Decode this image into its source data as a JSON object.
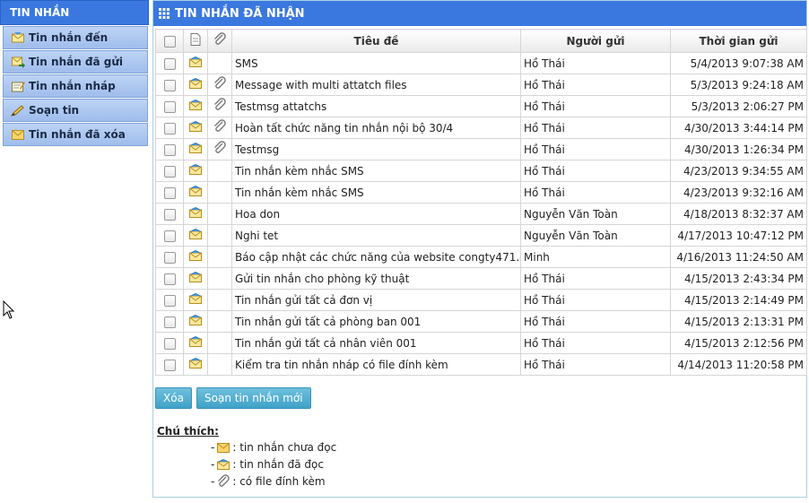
{
  "sidebar": {
    "header": "TIN NHẮN",
    "items": [
      {
        "label": "Tin nhắn đến",
        "icon": "inbox-icon"
      },
      {
        "label": "Tin nhắn đã gửi",
        "icon": "sent-icon"
      },
      {
        "label": "Tin nhắn nháp",
        "icon": "draft-icon"
      },
      {
        "label": "Soạn tin",
        "icon": "compose-icon"
      },
      {
        "label": "Tin nhắn đã xóa",
        "icon": "deleted-icon"
      }
    ]
  },
  "main": {
    "title": "TIN NHẮN ĐÃ NHẬN",
    "columns": {
      "subject": "Tiêu đề",
      "sender": "Người gửi",
      "time": "Thời gian gửi"
    },
    "rows": [
      {
        "subject": "SMS",
        "sender": "Hồ Thái",
        "time": "5/4/2013 9:07:38 AM",
        "attach": false
      },
      {
        "subject": "Message with multi attatch files",
        "sender": "Hồ Thái",
        "time": "5/3/2013 9:24:18 AM",
        "attach": true
      },
      {
        "subject": "Testmsg attatchs",
        "sender": "Hồ Thái",
        "time": "5/3/2013 2:06:27 PM",
        "attach": true
      },
      {
        "subject": "Hoàn tất chức năng tin nhắn nội bộ 30/4",
        "sender": "Hồ Thái",
        "time": "4/30/2013 3:44:14 PM",
        "attach": true
      },
      {
        "subject": "Testmsg",
        "sender": "Hồ Thái",
        "time": "4/30/2013 1:26:34 PM",
        "attach": true
      },
      {
        "subject": "Tin nhắn kèm nhắc SMS",
        "sender": "Hồ Thái",
        "time": "4/23/2013 9:34:55 AM",
        "attach": false
      },
      {
        "subject": "Tin nhắn kèm nhắc SMS",
        "sender": "Hồ Thái",
        "time": "4/23/2013 9:32:16 AM",
        "attach": false
      },
      {
        "subject": "Hoa don",
        "sender": "Nguyễn Văn Toàn",
        "time": "4/18/2013 8:32:37 AM",
        "attach": false
      },
      {
        "subject": "Nghi tet",
        "sender": "Nguyễn Văn Toàn",
        "time": "4/17/2013 10:47:12 PM",
        "attach": false
      },
      {
        "subject": "Báo cập nhật các chức năng của website congty471.com",
        "sender": "Minh",
        "time": "4/16/2013 11:24:50 AM",
        "attach": false
      },
      {
        "subject": "Gửi tin nhắn cho phòng kỹ thuật",
        "sender": "Hồ Thái",
        "time": "4/15/2013 2:43:34 PM",
        "attach": false
      },
      {
        "subject": "Tin nhắn gửi tất cả đơn vị",
        "sender": "Hồ Thái",
        "time": "4/15/2013 2:14:49 PM",
        "attach": false
      },
      {
        "subject": "Tin nhắn gửi tất cả phòng ban 001",
        "sender": "Hồ Thái",
        "time": "4/15/2013 2:13:31 PM",
        "attach": false
      },
      {
        "subject": "Tin nhắn gửi tất cả nhân viên 001",
        "sender": "Hồ Thái",
        "time": "4/15/2013 2:12:56 PM",
        "attach": false
      },
      {
        "subject": "Kiểm tra tin nhắn nháp có file đính kèm",
        "sender": "Hồ Thái",
        "time": "4/14/2013 11:20:58 PM",
        "attach": false
      }
    ],
    "buttons": {
      "delete": "Xóa",
      "compose": "Soạn tin nhắn mới"
    },
    "legend": {
      "title": "Chú thích:",
      "unread": ": tin nhắn chưa đọc",
      "read": ": tin nhắn đã đọc",
      "attach": ": có file đính kèm"
    }
  },
  "colors": {
    "header_blue": "#3a78e0",
    "button_teal": "#4aa9cf",
    "sidebar_item": "#aac5ef"
  }
}
